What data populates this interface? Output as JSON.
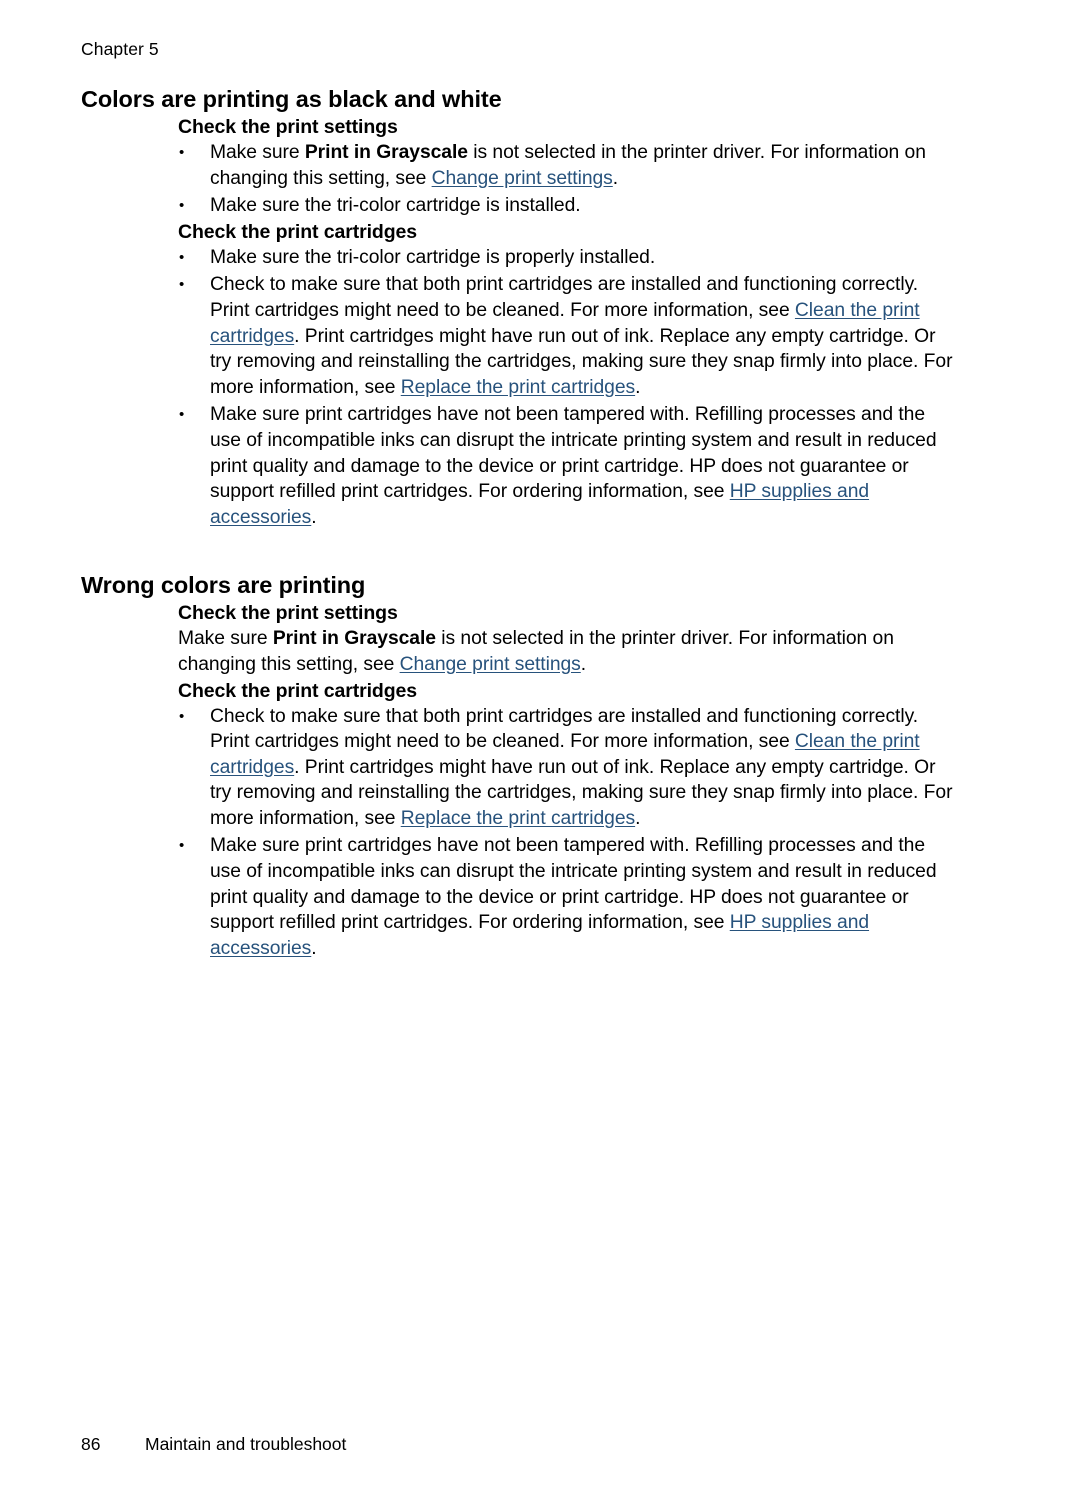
{
  "document": {
    "running_header": "Chapter 5",
    "page_number": "86",
    "footer_label": "Maintain and troubleshoot",
    "link_color": "#27527c",
    "text_color": "#000000",
    "background_color": "#ffffff"
  },
  "sections": [
    {
      "title": "Colors are printing as black and white",
      "groups": [
        {
          "heading": "Check the print settings",
          "bullets": [
            {
              "parts": [
                {
                  "type": "text",
                  "value": "Make sure "
                },
                {
                  "type": "bold",
                  "value": "Print in Grayscale"
                },
                {
                  "type": "text",
                  "value": " is not selected in the printer driver. For information on changing this setting, see "
                },
                {
                  "type": "link",
                  "value": "Change print settings"
                },
                {
                  "type": "text",
                  "value": "."
                }
              ]
            },
            {
              "parts": [
                {
                  "type": "text",
                  "value": "Make sure the tri-color cartridge is installed."
                }
              ]
            }
          ]
        },
        {
          "heading": "Check the print cartridges",
          "bullets": [
            {
              "parts": [
                {
                  "type": "text",
                  "value": "Make sure the tri-color cartridge is properly installed."
                }
              ]
            },
            {
              "parts": [
                {
                  "type": "text",
                  "value": "Check to make sure that both print cartridges are installed and functioning correctly. Print cartridges might need to be cleaned. For more information, see "
                },
                {
                  "type": "link",
                  "value": "Clean the print cartridges"
                },
                {
                  "type": "text",
                  "value": ". Print cartridges might have run out of ink. Replace any empty cartridge. Or try removing and reinstalling the cartridges, making sure they snap firmly into place. For more information, see "
                },
                {
                  "type": "link",
                  "value": "Replace the print cartridges"
                },
                {
                  "type": "text",
                  "value": "."
                }
              ]
            },
            {
              "parts": [
                {
                  "type": "text",
                  "value": "Make sure print cartridges have not been tampered with. Refilling processes and the use of incompatible inks can disrupt the intricate printing system and result in reduced print quality and damage to the device or print cartridge. HP does not guarantee or support refilled print cartridges. For ordering information, see "
                },
                {
                  "type": "link",
                  "value": "HP supplies and accessories"
                },
                {
                  "type": "text",
                  "value": "."
                }
              ]
            }
          ]
        }
      ]
    },
    {
      "title": "Wrong colors are printing",
      "groups": [
        {
          "heading": "Check the print settings",
          "paragraphs": [
            {
              "parts": [
                {
                  "type": "text",
                  "value": "Make sure "
                },
                {
                  "type": "bold",
                  "value": "Print in Grayscale"
                },
                {
                  "type": "text",
                  "value": " is not selected in the printer driver. For information on changing this setting, see "
                },
                {
                  "type": "link",
                  "value": "Change print settings"
                },
                {
                  "type": "text",
                  "value": "."
                }
              ]
            }
          ]
        },
        {
          "heading": "Check the print cartridges",
          "bullets": [
            {
              "parts": [
                {
                  "type": "text",
                  "value": "Check to make sure that both print cartridges are installed and functioning correctly. Print cartridges might need to be cleaned. For more information, see "
                },
                {
                  "type": "link",
                  "value": "Clean the print cartridges"
                },
                {
                  "type": "text",
                  "value": ". Print cartridges might have run out of ink. Replace any empty cartridge. Or try removing and reinstalling the cartridges, making sure they snap firmly into place. For more information, see "
                },
                {
                  "type": "link",
                  "value": "Replace the print cartridges"
                },
                {
                  "type": "text",
                  "value": "."
                }
              ]
            },
            {
              "parts": [
                {
                  "type": "text",
                  "value": "Make sure print cartridges have not been tampered with. Refilling processes and the use of incompatible inks can disrupt the intricate printing system and result in reduced print quality and damage to the device or print cartridge. HP does not guarantee or support refilled print cartridges. For ordering information, see "
                },
                {
                  "type": "link",
                  "value": "HP supplies and accessories"
                },
                {
                  "type": "text",
                  "value": "."
                }
              ]
            }
          ]
        }
      ]
    }
  ]
}
